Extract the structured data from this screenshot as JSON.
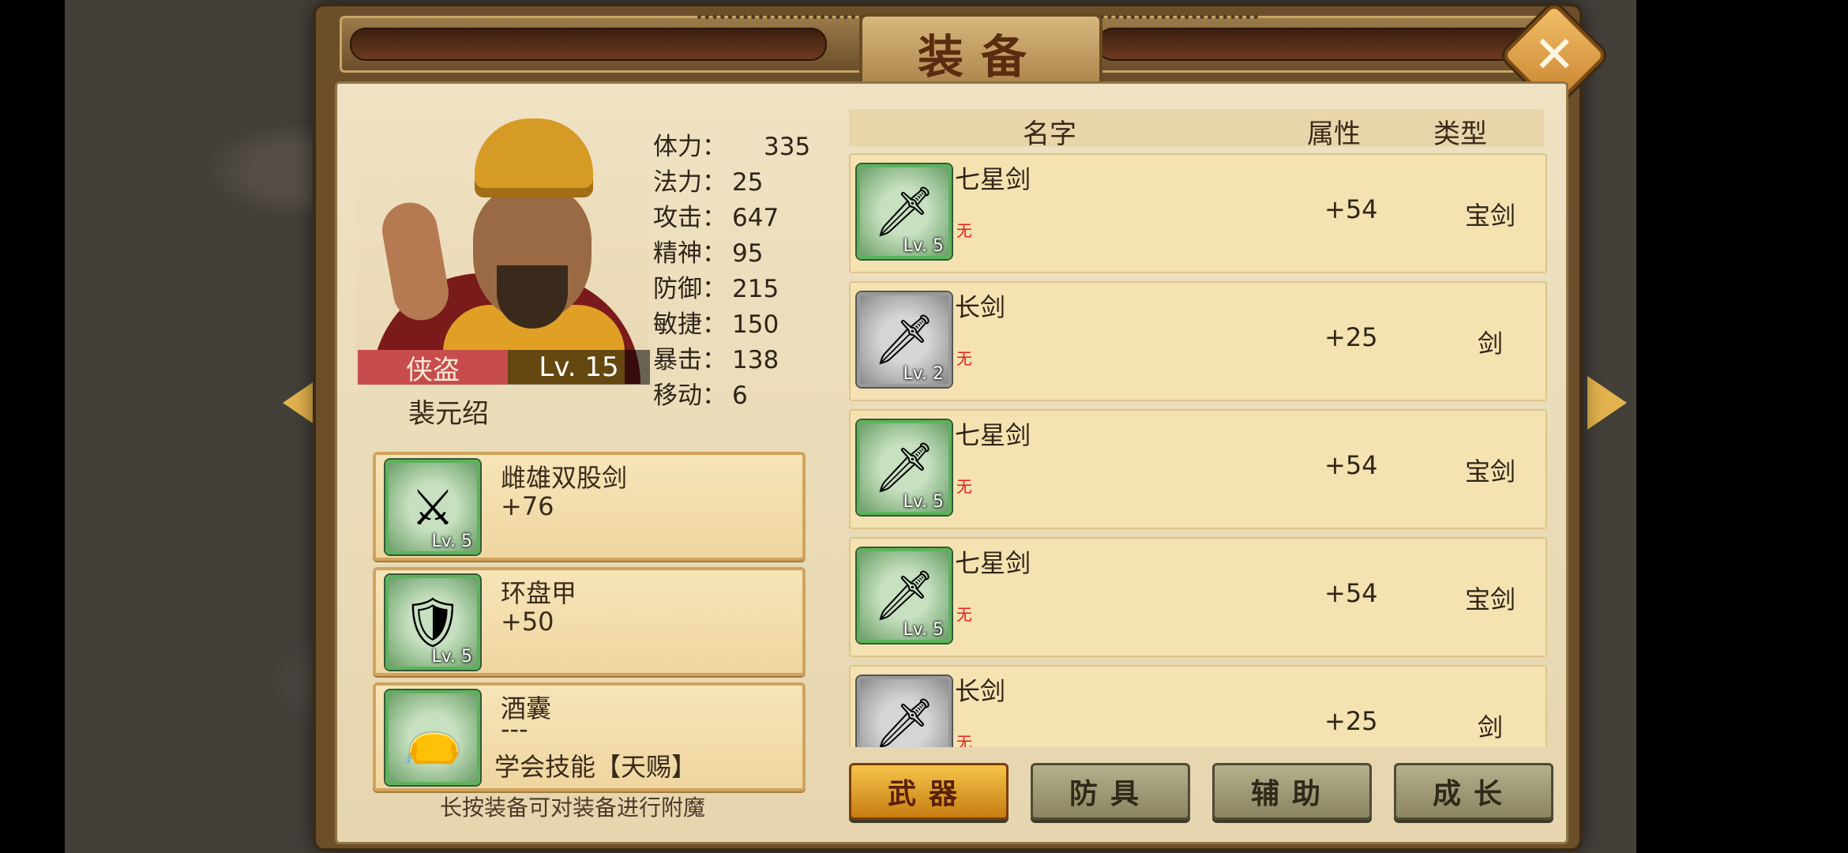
{
  "panel_title": "装备",
  "close_label": "✕",
  "hero": {
    "class_label": "侠盗",
    "level_label": "Lv. 15",
    "name": "裴元绍",
    "stats": [
      {
        "key": "体力：",
        "value": "335"
      },
      {
        "key": "法力：",
        "value": "25"
      },
      {
        "key": "攻击：",
        "value": "647"
      },
      {
        "key": "精神：",
        "value": "95"
      },
      {
        "key": "防御：",
        "value": "215"
      },
      {
        "key": "敏捷：",
        "value": "150"
      },
      {
        "key": "暴击：",
        "value": "138"
      },
      {
        "key": "移动：",
        "value": "6"
      }
    ]
  },
  "equipped": [
    {
      "name": "雌雄双股剑",
      "value": "+76",
      "level": "Lv. 5",
      "icon": "twin-swords-icon"
    },
    {
      "name": "环盘甲",
      "value": "+50",
      "level": "Lv. 5",
      "icon": "armor-icon"
    },
    {
      "name": "酒囊",
      "value": "---",
      "skill": "学会技能【天赐】",
      "icon": "wine-gourd-icon"
    }
  ],
  "hint": "长按装备可对装备进行附魔",
  "list_headers": {
    "name": "名字",
    "attr": "属性",
    "type": "类型"
  },
  "items": [
    {
      "name": "七星剑",
      "ench": "无",
      "attr": "+54",
      "type": "宝剑",
      "level": "Lv. 5",
      "frame": "green"
    },
    {
      "name": "长剑",
      "ench": "无",
      "attr": "+25",
      "type": "剑",
      "level": "Lv. 2",
      "frame": "gray"
    },
    {
      "name": "七星剑",
      "ench": "无",
      "attr": "+54",
      "type": "宝剑",
      "level": "Lv. 5",
      "frame": "green"
    },
    {
      "name": "七星剑",
      "ench": "无",
      "attr": "+54",
      "type": "宝剑",
      "level": "Lv. 5",
      "frame": "green"
    },
    {
      "name": "长剑",
      "ench": "无",
      "attr": "+25",
      "type": "剑",
      "level": "",
      "frame": "gray"
    }
  ],
  "tabs": [
    "武器",
    "防具",
    "辅助",
    "成长"
  ],
  "active_tab": "武器"
}
